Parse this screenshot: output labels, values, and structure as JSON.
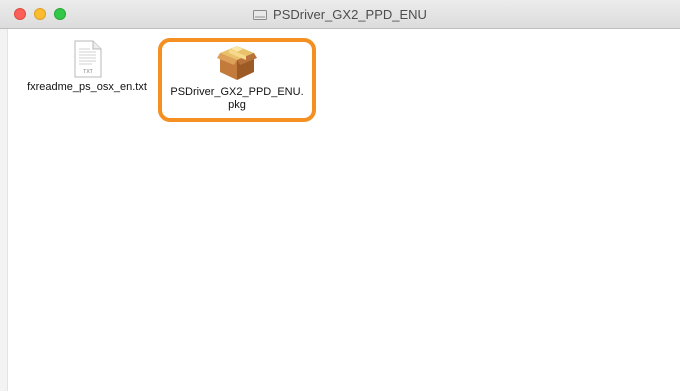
{
  "window": {
    "title": "PSDriver_GX2_PPD_ENU"
  },
  "files": [
    {
      "name": "fxreadme_ps_osx_en.txt",
      "icon": "text-file-icon",
      "icon_caption": "TXT"
    },
    {
      "name": "PSDriver_GX2_PPD_ENU.pkg",
      "icon": "package-icon",
      "highlighted": true,
      "highlight_color": "#f39021"
    }
  ],
  "colors": {
    "close": "#fc5f57",
    "minimize": "#fdbc2e",
    "maximize": "#33c748"
  }
}
